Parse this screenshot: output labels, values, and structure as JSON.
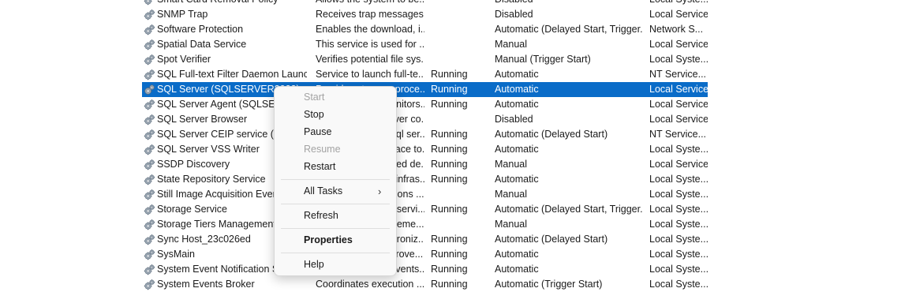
{
  "services": [
    {
      "name": "Smart Card Removal Policy",
      "description": "Allows the system to be...",
      "status": "",
      "startup": "Disabled",
      "logon": "Local Syste..."
    },
    {
      "name": "SNMP Trap",
      "description": "Receives trap messages...",
      "status": "",
      "startup": "Disabled",
      "logon": "Local Service"
    },
    {
      "name": "Software Protection",
      "description": "Enables the download, i...",
      "status": "",
      "startup": "Automatic (Delayed Start, Trigger...",
      "logon": "Network S..."
    },
    {
      "name": "Spatial Data Service",
      "description": "This service is used for ...",
      "status": "",
      "startup": "Manual",
      "logon": "Local Service"
    },
    {
      "name": "Spot Verifier",
      "description": "Verifies potential file sys...",
      "status": "",
      "startup": "Manual (Trigger Start)",
      "logon": "Local Syste..."
    },
    {
      "name": "SQL Full-text Filter Daemon Launc...",
      "description": "Service to launch full-te...",
      "status": "Running",
      "startup": "Automatic",
      "logon": "NT Service..."
    },
    {
      "name": "SQL Server (SQLSERVER2022)",
      "description": "Provides storage, proce...",
      "status": "Running",
      "startup": "Automatic",
      "logon": "Local Service"
    },
    {
      "name": "SQL Server Agent (SQLSERVER2022)",
      "description": "Executes jobs, monitors...",
      "status": "Running",
      "startup": "Automatic",
      "logon": "Local Service"
    },
    {
      "name": "SQL Server Browser",
      "description": "Provides SQL Server co...",
      "status": "",
      "startup": "Disabled",
      "logon": "Local Service"
    },
    {
      "name": "SQL Server CEIP service (SQLSERVER2022)",
      "description": "CEIP service for Sql ser...",
      "status": "Running",
      "startup": "Automatic (Delayed Start)",
      "logon": "NT Service..."
    },
    {
      "name": "SQL Server VSS Writer",
      "description": "Provides the interface to...",
      "status": "Running",
      "startup": "Automatic",
      "logon": "Local Syste..."
    },
    {
      "name": "SSDP Discovery",
      "description": "Discovers networked de...",
      "status": "Running",
      "startup": "Manual",
      "logon": "Local Service"
    },
    {
      "name": "State Repository Service",
      "description": "Provides required infras...",
      "status": "Running",
      "startup": "Automatic",
      "logon": "Local Syste..."
    },
    {
      "name": "Still Image Acquisition Events",
      "description": "Launches applications ...",
      "status": "",
      "startup": "Manual",
      "logon": "Local Syste..."
    },
    {
      "name": "Storage Service",
      "description": "Provides enabling servi...",
      "status": "Running",
      "startup": "Automatic (Delayed Start, Trigger...",
      "logon": "Local Syste..."
    },
    {
      "name": "Storage Tiers Management",
      "description": "Optimizes the placeme...",
      "status": "",
      "startup": "Manual",
      "logon": "Local Syste..."
    },
    {
      "name": "Sync Host_23c026ed",
      "description": "This service synchroniz...",
      "status": "Running",
      "startup": "Automatic (Delayed Start)",
      "logon": "Local Syste..."
    },
    {
      "name": "SysMain",
      "description": "Maintains and improve...",
      "status": "Running",
      "startup": "Automatic",
      "logon": "Local Syste..."
    },
    {
      "name": "System Event Notification Service",
      "description": "Monitors system events...",
      "status": "Running",
      "startup": "Automatic",
      "logon": "Local Syste..."
    },
    {
      "name": "System Events Broker",
      "description": "Coordinates execution ...",
      "status": "Running",
      "startup": "Automatic (Trigger Start)",
      "logon": "Local Syste..."
    }
  ],
  "selected_index": 6,
  "context_menu": {
    "start": "Start",
    "stop": "Stop",
    "pause": "Pause",
    "resume": "Resume",
    "restart": "Restart",
    "all_tasks": "All Tasks",
    "all_tasks_arrow": "›",
    "refresh": "Refresh",
    "properties": "Properties",
    "help": "Help"
  },
  "colors": {
    "selection": "#0a6cc8",
    "menu_bg": "#f9f9f9",
    "disabled_text": "#a3a3a3"
  }
}
